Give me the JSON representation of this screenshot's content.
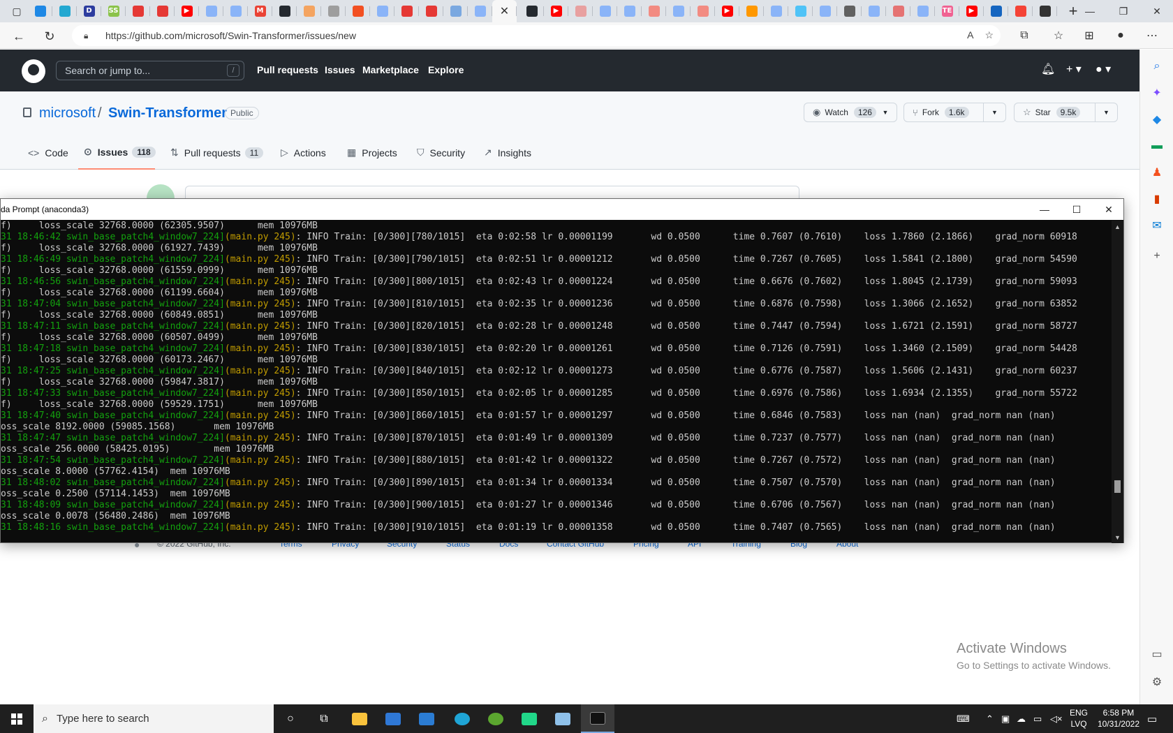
{
  "browser": {
    "tabs": [
      {
        "icon": "doc-icon",
        "color": "#1e88e5",
        "glyph": ""
      },
      {
        "icon": "edge-icon",
        "color": "#23a8d1",
        "glyph": ""
      },
      {
        "icon": "d-app-icon",
        "color": "#2d3d9f",
        "glyph": "D"
      },
      {
        "icon": "ss-icon",
        "color": "#8bc34a",
        "glyph": "SS"
      },
      {
        "icon": "bag-icon",
        "color": "#e53935",
        "glyph": ""
      },
      {
        "icon": "bag-icon",
        "color": "#e53935",
        "glyph": ""
      },
      {
        "icon": "youtube-icon",
        "color": "#ff0000",
        "glyph": "▶"
      },
      {
        "icon": "search-icon",
        "color": "#8ab4f8",
        "glyph": ""
      },
      {
        "icon": "search-icon",
        "color": "#8ab4f8",
        "glyph": ""
      },
      {
        "icon": "gmail-icon",
        "color": "#ea4335",
        "glyph": "M"
      },
      {
        "icon": "github-icon",
        "color": "#24292f",
        "glyph": ""
      },
      {
        "icon": "chat-icon",
        "color": "#f4a460",
        "glyph": ""
      },
      {
        "icon": "page-icon",
        "color": "#9e9e9e",
        "glyph": ""
      },
      {
        "icon": "ms-icon",
        "color": "#f25022",
        "glyph": ""
      },
      {
        "icon": "search-icon",
        "color": "#8ab4f8",
        "glyph": ""
      },
      {
        "icon": "bag-icon",
        "color": "#e53935",
        "glyph": ""
      },
      {
        "icon": "bag-icon",
        "color": "#e53935",
        "glyph": ""
      },
      {
        "icon": "shield-icon",
        "color": "#7aa8e0",
        "glyph": ""
      },
      {
        "icon": "search-icon",
        "color": "#8ab4f8",
        "glyph": ""
      }
    ],
    "active_tab_glyph": "✕",
    "tabs_right": [
      {
        "icon": "github-icon",
        "color": "#24292f",
        "glyph": ""
      },
      {
        "icon": "youtube-icon",
        "color": "#ff0000",
        "glyph": "▶"
      },
      {
        "icon": "avatar-icon",
        "color": "#e8a0a0",
        "glyph": ""
      },
      {
        "icon": "search-icon",
        "color": "#8ab4f8",
        "glyph": ""
      },
      {
        "icon": "search-icon",
        "color": "#8ab4f8",
        "glyph": ""
      },
      {
        "icon": "opera-icon",
        "color": "#f28b82",
        "glyph": ""
      },
      {
        "icon": "search-icon",
        "color": "#8ab4f8",
        "glyph": ""
      },
      {
        "icon": "opera-icon",
        "color": "#f28b82",
        "glyph": ""
      },
      {
        "icon": "youtube-icon",
        "color": "#ff0000",
        "glyph": "▶"
      },
      {
        "icon": "puzzle-icon",
        "color": "#ff9800",
        "glyph": ""
      },
      {
        "icon": "search-icon",
        "color": "#8ab4f8",
        "glyph": ""
      },
      {
        "icon": "c-icon",
        "color": "#4fc3f7",
        "glyph": ""
      },
      {
        "icon": "search-icon",
        "color": "#8ab4f8",
        "glyph": ""
      },
      {
        "icon": "photo-icon",
        "color": "#616161",
        "glyph": ""
      },
      {
        "icon": "search-icon",
        "color": "#8ab4f8",
        "glyph": ""
      },
      {
        "icon": "cross-icon",
        "color": "#e57373",
        "glyph": ""
      },
      {
        "icon": "search-icon",
        "color": "#8ab4f8",
        "glyph": ""
      },
      {
        "icon": "te-icon",
        "color": "#f06292",
        "glyph": "TE"
      },
      {
        "icon": "youtube-icon",
        "color": "#ff0000",
        "glyph": "▶"
      },
      {
        "icon": "search-icon",
        "color": "#1565c0",
        "glyph": ""
      },
      {
        "icon": "opera-icon",
        "color": "#f44336",
        "glyph": ""
      },
      {
        "icon": "terminal-icon",
        "color": "#333333",
        "glyph": ""
      }
    ],
    "url": "https://github.com/microsoft/Swin-Transformer/issues/new"
  },
  "github": {
    "search_placeholder": "Search or jump to...",
    "search_shortcut": "/",
    "nav": [
      "Pull requests",
      "Issues",
      "Marketplace",
      "Explore"
    ],
    "owner": "microsoft",
    "separator": "/",
    "repo": "Swin-Transformer",
    "visibility": "Public",
    "watch_label": "Watch",
    "watch_count": "126",
    "fork_label": "Fork",
    "fork_count": "1.6k",
    "star_label": "Star",
    "star_count": "9.5k",
    "tabs": [
      {
        "label": "Code",
        "icon": "code-icon",
        "glyph": "<>",
        "count": ""
      },
      {
        "label": "Issues",
        "icon": "issue-icon",
        "glyph": "⊙",
        "count": "118"
      },
      {
        "label": "Pull requests",
        "icon": "pull-request-icon",
        "glyph": "⇅",
        "count": "11"
      },
      {
        "label": "Actions",
        "icon": "play-icon",
        "glyph": "▷",
        "count": ""
      },
      {
        "label": "Projects",
        "icon": "table-icon",
        "glyph": "▦",
        "count": ""
      },
      {
        "label": "Security",
        "icon": "shield-icon",
        "glyph": "⛉",
        "count": ""
      },
      {
        "label": "Insights",
        "icon": "graph-icon",
        "glyph": "↗",
        "count": ""
      }
    ],
    "footer": {
      "copyright": "© 2022 GitHub, Inc.",
      "links": [
        "Terms",
        "Privacy",
        "Security",
        "Status",
        "Docs",
        "Contact GitHub",
        "Pricing",
        "API",
        "Training",
        "Blog",
        "About"
      ]
    }
  },
  "console": {
    "title": "da Prompt (anaconda3)",
    "lines": [
      [
        {
          "t": "f)     loss_scale 32768.0000 (62305.9507)      mem 10976MB",
          "c": ""
        }
      ],
      [
        {
          "t": "31 18:46:42 swin_base_patch4_window7_224]",
          "c": "ts"
        },
        {
          "t": "(main.py 245)",
          "c": "mod"
        },
        {
          "t": ": INFO Train: [0/300][780/1015]  eta 0:02:58 lr 0.00001199       wd 0.0500      time 0.7607 (0.7610)    loss 1.7860 (2.1866)    grad_norm 60918",
          "c": ""
        }
      ],
      [
        {
          "t": "f)     loss_scale 32768.0000 (61927.7439)      mem 10976MB",
          "c": ""
        }
      ],
      [
        {
          "t": "31 18:46:49 swin_base_patch4_window7_224]",
          "c": "ts"
        },
        {
          "t": "(main.py 245)",
          "c": "mod"
        },
        {
          "t": ": INFO Train: [0/300][790/1015]  eta 0:02:51 lr 0.00001212       wd 0.0500      time 0.7267 (0.7605)    loss 1.5841 (2.1800)    grad_norm 54590",
          "c": ""
        }
      ],
      [
        {
          "t": "f)     loss_scale 32768.0000 (61559.0999)      mem 10976MB",
          "c": ""
        }
      ],
      [
        {
          "t": "31 18:46:56 swin_base_patch4_window7_224]",
          "c": "ts"
        },
        {
          "t": "(main.py 245)",
          "c": "mod"
        },
        {
          "t": ": INFO Train: [0/300][800/1015]  eta 0:02:43 lr 0.00001224       wd 0.0500      time 0.6676 (0.7602)    loss 1.8045 (2.1739)    grad_norm 59093",
          "c": ""
        }
      ],
      [
        {
          "t": "f)     loss_scale 32768.0000 (61199.6604)      mem 10976MB",
          "c": ""
        }
      ],
      [
        {
          "t": "31 18:47:04 swin_base_patch4_window7_224]",
          "c": "ts"
        },
        {
          "t": "(main.py 245)",
          "c": "mod"
        },
        {
          "t": ": INFO Train: [0/300][810/1015]  eta 0:02:35 lr 0.00001236       wd 0.0500      time 0.6876 (0.7598)    loss 1.3066 (2.1652)    grad_norm 63852",
          "c": ""
        }
      ],
      [
        {
          "t": "f)     loss_scale 32768.0000 (60849.0851)      mem 10976MB",
          "c": ""
        }
      ],
      [
        {
          "t": "31 18:47:11 swin_base_patch4_window7_224]",
          "c": "ts"
        },
        {
          "t": "(main.py 245)",
          "c": "mod"
        },
        {
          "t": ": INFO Train: [0/300][820/1015]  eta 0:02:28 lr 0.00001248       wd 0.0500      time 0.7447 (0.7594)    loss 1.6721 (2.1591)    grad_norm 58727",
          "c": ""
        }
      ],
      [
        {
          "t": "f)     loss_scale 32768.0000 (60507.0499)      mem 10976MB",
          "c": ""
        }
      ],
      [
        {
          "t": "31 18:47:18 swin_base_patch4_window7_224]",
          "c": "ts"
        },
        {
          "t": "(main.py 245)",
          "c": "mod"
        },
        {
          "t": ": INFO Train: [0/300][830/1015]  eta 0:02:20 lr 0.00001261       wd 0.0500      time 0.7126 (0.7591)    loss 1.3460 (2.1509)    grad_norm 54428",
          "c": ""
        }
      ],
      [
        {
          "t": "f)     loss_scale 32768.0000 (60173.2467)      mem 10976MB",
          "c": ""
        }
      ],
      [
        {
          "t": "31 18:47:25 swin_base_patch4_window7_224]",
          "c": "ts"
        },
        {
          "t": "(main.py 245)",
          "c": "mod"
        },
        {
          "t": ": INFO Train: [0/300][840/1015]  eta 0:02:12 lr 0.00001273       wd 0.0500      time 0.6776 (0.7587)    loss 1.5606 (2.1431)    grad_norm 60237",
          "c": ""
        }
      ],
      [
        {
          "t": "f)     loss_scale 32768.0000 (59847.3817)      mem 10976MB",
          "c": ""
        }
      ],
      [
        {
          "t": "31 18:47:33 swin_base_patch4_window7_224]",
          "c": "ts"
        },
        {
          "t": "(main.py 245)",
          "c": "mod"
        },
        {
          "t": ": INFO Train: [0/300][850/1015]  eta 0:02:05 lr 0.00001285       wd 0.0500      time 0.6976 (0.7586)    loss 1.6934 (2.1355)    grad_norm 55722",
          "c": ""
        }
      ],
      [
        {
          "t": "f)     loss_scale 32768.0000 (59529.1751)      mem 10976MB",
          "c": ""
        }
      ],
      [
        {
          "t": "31 18:47:40 swin_base_patch4_window7_224]",
          "c": "ts"
        },
        {
          "t": "(main.py 245)",
          "c": "mod"
        },
        {
          "t": ": INFO Train: [0/300][860/1015]  eta 0:01:57 lr 0.00001297       wd 0.0500      time 0.6846 (0.7583)    loss nan (nan)  grad_norm nan (nan)",
          "c": ""
        }
      ],
      [
        {
          "t": "oss_scale 8192.0000 (59085.1568)       mem 10976MB",
          "c": ""
        }
      ],
      [
        {
          "t": "31 18:47:47 swin_base_patch4_window7_224]",
          "c": "ts"
        },
        {
          "t": "(main.py 245)",
          "c": "mod"
        },
        {
          "t": ": INFO Train: [0/300][870/1015]  eta 0:01:49 lr 0.00001309       wd 0.0500      time 0.7237 (0.7577)    loss nan (nan)  grad_norm nan (nan)",
          "c": ""
        }
      ],
      [
        {
          "t": "oss_scale 256.0000 (58425.0195)        mem 10976MB",
          "c": ""
        }
      ],
      [
        {
          "t": "31 18:47:54 swin_base_patch4_window7_224]",
          "c": "ts"
        },
        {
          "t": "(main.py 245)",
          "c": "mod"
        },
        {
          "t": ": INFO Train: [0/300][880/1015]  eta 0:01:42 lr 0.00001322       wd 0.0500      time 0.7267 (0.7572)    loss nan (nan)  grad_norm nan (nan)",
          "c": ""
        }
      ],
      [
        {
          "t": "oss_scale 8.0000 (57762.4154)  mem 10976MB",
          "c": ""
        }
      ],
      [
        {
          "t": "31 18:48:02 swin_base_patch4_window7_224]",
          "c": "ts"
        },
        {
          "t": "(main.py 245)",
          "c": "mod"
        },
        {
          "t": ": INFO Train: [0/300][890/1015]  eta 0:01:34 lr 0.00001334       wd 0.0500      time 0.7507 (0.7570)    loss nan (nan)  grad_norm nan (nan)",
          "c": ""
        }
      ],
      [
        {
          "t": "oss_scale 0.2500 (57114.1453)  mem 10976MB",
          "c": ""
        }
      ],
      [
        {
          "t": "31 18:48:09 swin_base_patch4_window7_224]",
          "c": "ts"
        },
        {
          "t": "(main.py 245)",
          "c": "mod"
        },
        {
          "t": ": INFO Train: [0/300][900/1015]  eta 0:01:27 lr 0.00001346       wd 0.0500      time 0.6706 (0.7567)    loss nan (nan)  grad_norm nan (nan)",
          "c": ""
        }
      ],
      [
        {
          "t": "oss_scale 0.0078 (56480.2486)  mem 10976MB",
          "c": ""
        }
      ],
      [
        {
          "t": "31 18:48:16 swin_base_patch4_window7_224]",
          "c": "ts"
        },
        {
          "t": "(main.py 245)",
          "c": "mod"
        },
        {
          "t": ": INFO Train: [0/300][910/1015]  eta 0:01:19 lr 0.00001358       wd 0.0500      time 0.7407 (0.7565)    loss nan (nan)  grad_norm nan (nan)",
          "c": ""
        }
      ]
    ]
  },
  "activation": {
    "title": "Activate Windows",
    "subtitle": "Go to Settings to activate Windows."
  },
  "taskbar": {
    "search_placeholder": "Type here to search",
    "lang_top": "ENG",
    "lang_bottom": "LVQ",
    "time": "6:58 PM",
    "date": "10/31/2022"
  }
}
